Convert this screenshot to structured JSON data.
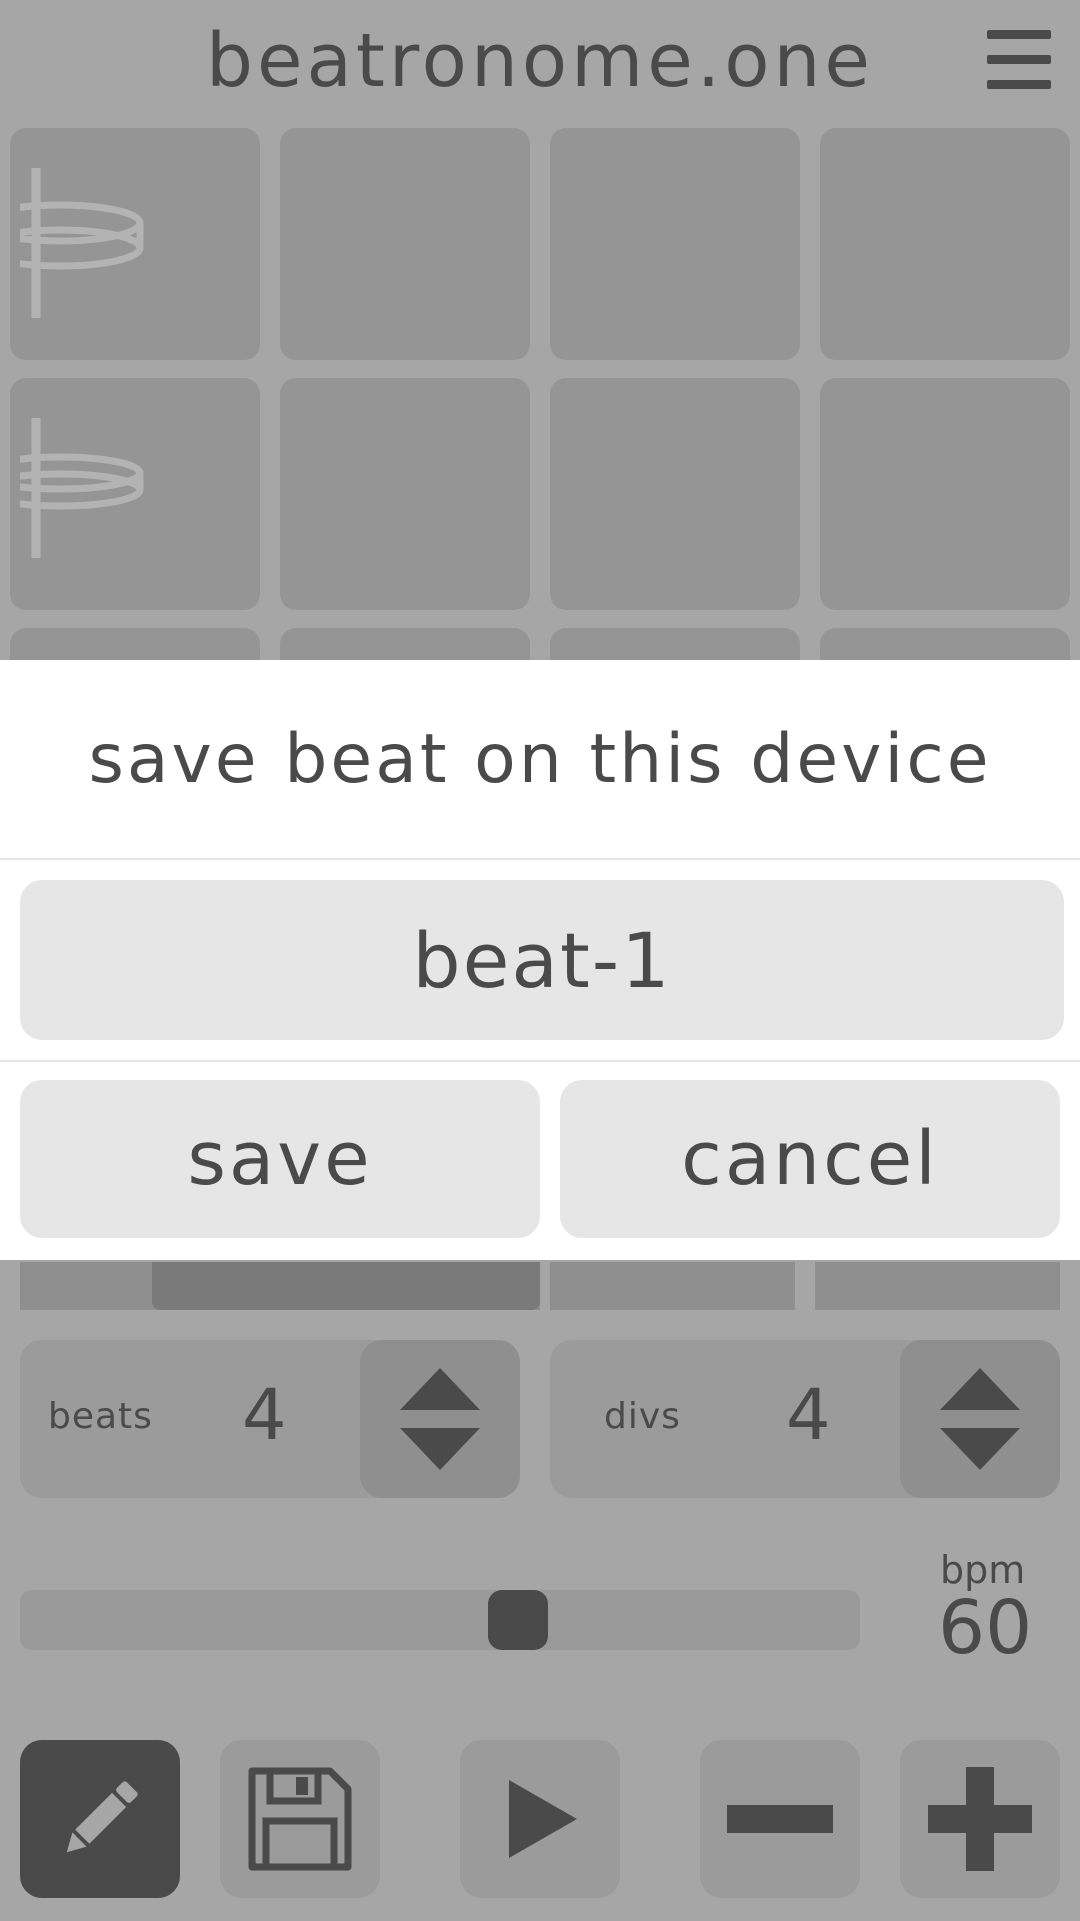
{
  "app": {
    "title": "beatronome.one"
  },
  "modal": {
    "heading": "save beat on this device",
    "name_value": "beat-1",
    "save_label": "save",
    "cancel_label": "cancel"
  },
  "controls": {
    "beats_label": "beats",
    "beats_value": "4",
    "divs_label": "divs",
    "divs_value": "4",
    "bpm_label": "bpm",
    "bpm_value": "60",
    "tempo_slider_fraction": 0.6
  },
  "toolbar": {
    "edit_active": true,
    "icons": [
      "pencil-icon",
      "floppy-disk-icon",
      "play-icon",
      "minus-icon",
      "plus-icon"
    ]
  },
  "colors": {
    "background": "#a6a6a6",
    "cell": "#959595",
    "dark": "#4a4a4a",
    "modal": "#ffffff",
    "modal_button": "#e6e6e6"
  }
}
